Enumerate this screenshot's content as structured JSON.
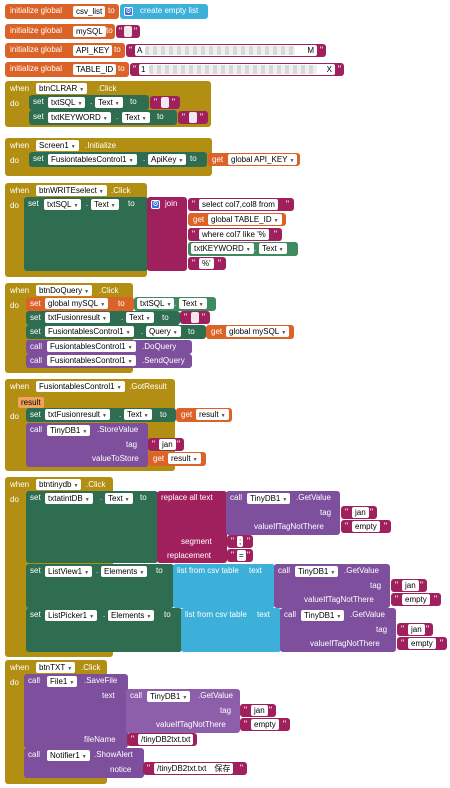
{
  "g1": {
    "init": "initialize global",
    "name": "csv_list",
    "to": "to",
    "create": "create empty list"
  },
  "g2": {
    "init": "initialize global",
    "name": "mySQL",
    "to": "to"
  },
  "g3": {
    "init": "initialize global",
    "name": "API_KEY",
    "to": "to",
    "val_start": "A",
    "val_end": "M"
  },
  "g4": {
    "init": "initialize global",
    "name": "TABLE_ID",
    "to": "to",
    "val_start": "1",
    "val_end": "X"
  },
  "e1": {
    "when": "when",
    "comp": "btnCLRAR",
    "event": ".Click",
    "do": "do",
    "rows": [
      {
        "set": "set",
        "comp": "txtSQL",
        "prop": "Text",
        "to": "to"
      },
      {
        "set": "set",
        "comp": "txtKEYWORD",
        "prop": "Text",
        "to": "to"
      }
    ]
  },
  "e2": {
    "when": "when",
    "comp": "Screen1",
    "event": ".Initialize",
    "do": "do",
    "set": "set",
    "target": "FusiontablesControl1",
    "prop": "ApiKey",
    "to": "to",
    "get": "get",
    "var": "global API_KEY"
  },
  "e3": {
    "when": "when",
    "comp": "btnWRITEselect",
    "event": ".Click",
    "do": "do",
    "set": "set",
    "comp2": "txtSQL",
    "prop": "Text",
    "to": "to",
    "join": "join",
    "s1": "select col7,col8 from",
    "get": "get",
    "var": "global TABLE_ID",
    "s2": "where col7 like '%",
    "kw": "txtKEYWORD",
    "kwprop": "Text",
    "s3": "%'"
  },
  "e4": {
    "when": "when",
    "comp": "btnDoQuery",
    "event": ".Click",
    "do": "do",
    "r1": {
      "set": "set",
      "var": "global mySQL",
      "to": "to",
      "comp": "txtSQL",
      "prop": "Text"
    },
    "r2": {
      "set": "set",
      "comp": "txtFusionresult",
      "prop": "Text",
      "to": "to"
    },
    "r3": {
      "set": "set",
      "comp": "FusiontablesControl1",
      "prop": "Query",
      "to": "to",
      "get": "get",
      "var": "global mySQL"
    },
    "r4": {
      "call": "call",
      "comp": "FusiontablesControl1",
      "method": ".DoQuery"
    },
    "r5": {
      "call": "call",
      "comp": "FusiontablesControl1",
      "method": ".SendQuery"
    }
  },
  "e5": {
    "when": "when",
    "comp": "FusiontablesControl1",
    "event": ".GotResult",
    "param": "result",
    "do": "do",
    "r1": {
      "set": "set",
      "comp": "txtFusionresult",
      "prop": "Text",
      "to": "to",
      "get": "get",
      "var": "result"
    },
    "r2": {
      "call": "call",
      "comp": "TinyDB1",
      "method": ".StoreValue",
      "tag": "tag",
      "tagval": "jan",
      "vts": "valueToStore",
      "get": "get",
      "var": "result"
    }
  },
  "e6": {
    "when": "when",
    "comp": "btntinydb",
    "event": ".Click",
    "do": "do",
    "r1": {
      "set": "set",
      "comp": "txtatintDB",
      "prop": "Text",
      "to": "to",
      "replace": "replace all text",
      "call": "call",
      "db": "TinyDB1",
      "method": ".GetValue",
      "tag": "tag",
      "tagval": "jan",
      "vitnt": "valueIfTagNotThere",
      "empty": "empty",
      "segment": "segment",
      "seg": ";",
      "replacement": "replacement",
      "rep": "="
    },
    "r2": {
      "set": "set",
      "comp": "ListView1",
      "prop": "Elements",
      "to": "to",
      "lfct": "list from csv table",
      "text": "text",
      "call": "call",
      "db": "TinyDB1",
      "method": ".GetValue",
      "tag": "tag",
      "tagval": "jan",
      "vitnt": "valueIfTagNotThere",
      "empty": "empty"
    },
    "r3": {
      "set": "set",
      "comp": "ListPicker1",
      "prop": "Elements",
      "to": "to",
      "lfct": "list from csv table",
      "text": "text",
      "call": "call",
      "db": "TinyDB1",
      "method": ".GetValue",
      "tag": "tag",
      "tagval": "jan",
      "vitnt": "valueIfTagNotThere",
      "empty": "empty"
    }
  },
  "e7": {
    "when": "when",
    "comp": "btnTXT",
    "event": ".Click",
    "do": "do",
    "r1": {
      "call": "call",
      "comp": "File1",
      "method": ".SaveFile",
      "text": "text",
      "call2": "call",
      "db": "TinyDB1",
      "method2": ".GetValue",
      "tag": "tag",
      "tagval": "jan",
      "vitnt": "valueIfTagNotThere",
      "empty": "empty",
      "fileName": "fileName",
      "fn": "/tinyDB2txt.txt"
    },
    "r2": {
      "call": "call",
      "comp": "Notifier1",
      "method": ".ShowAlert",
      "notice": "notice",
      "nv": "/tinyDB2txt.txt　保存"
    }
  },
  "colors": {
    "control": "#b28f12",
    "variable": "#db6328",
    "component": "#2e6d50",
    "text": "#a0205d",
    "method": "#7d4f9c",
    "list": "#3db0d9"
  }
}
